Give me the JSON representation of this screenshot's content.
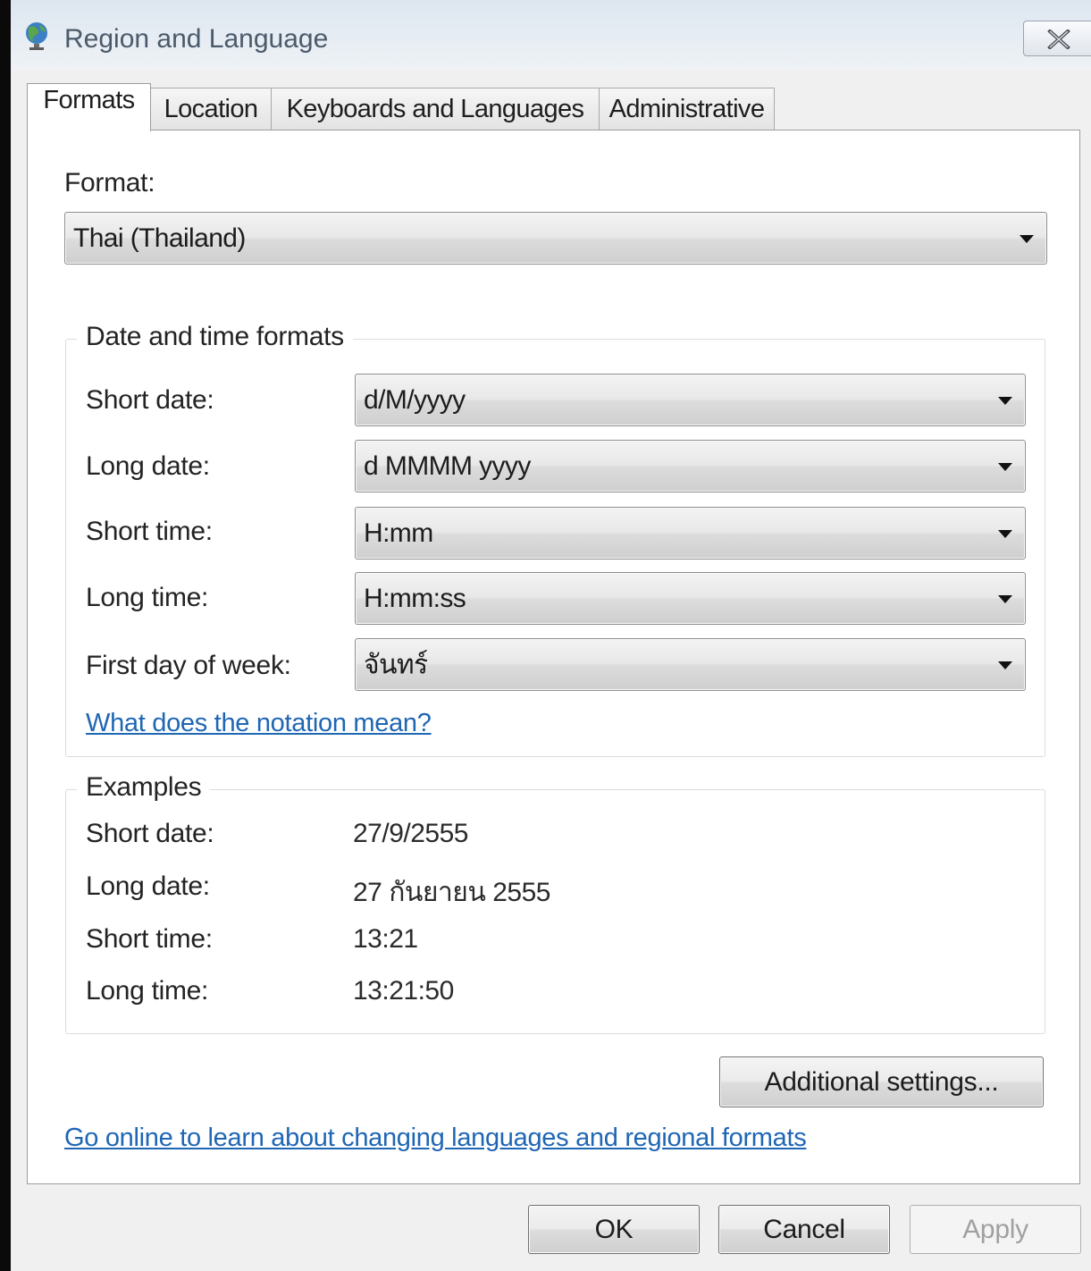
{
  "window": {
    "title": "Region and Language",
    "icons": {
      "app": "globe-icon",
      "close": "close-icon"
    }
  },
  "tabs": [
    {
      "label": "Formats",
      "active": true
    },
    {
      "label": "Location",
      "active": false
    },
    {
      "label": "Keyboards and Languages",
      "active": false
    },
    {
      "label": "Administrative",
      "active": false
    }
  ],
  "formats": {
    "format_label": "Format:",
    "format_value": "Thai (Thailand)",
    "date_time_group": {
      "legend": "Date and time formats",
      "short_date_label": "Short date:",
      "short_date_value": "d/M/yyyy",
      "long_date_label": "Long date:",
      "long_date_value": "d MMMM yyyy",
      "short_time_label": "Short time:",
      "short_time_value": "H:mm",
      "long_time_label": "Long time:",
      "long_time_value": "H:mm:ss",
      "first_day_label": "First day of week:",
      "first_day_value": "จันทร์",
      "notation_link": "What does the notation mean?"
    },
    "examples_group": {
      "legend": "Examples",
      "short_date_label": "Short date:",
      "short_date_value": "27/9/2555",
      "long_date_label": "Long date:",
      "long_date_value": "27 กันยายน 2555",
      "short_time_label": "Short time:",
      "short_time_value": "13:21",
      "long_time_label": "Long time:",
      "long_time_value": "13:21:50"
    },
    "additional_settings_label": "Additional settings...",
    "online_link": "Go online to learn about changing languages and regional formats"
  },
  "footer": {
    "ok_label": "OK",
    "cancel_label": "Cancel",
    "apply_label": "Apply"
  },
  "colors": {
    "link": "#1f66b4",
    "panel": "#ffffff",
    "dialog": "#f0f0f0"
  }
}
